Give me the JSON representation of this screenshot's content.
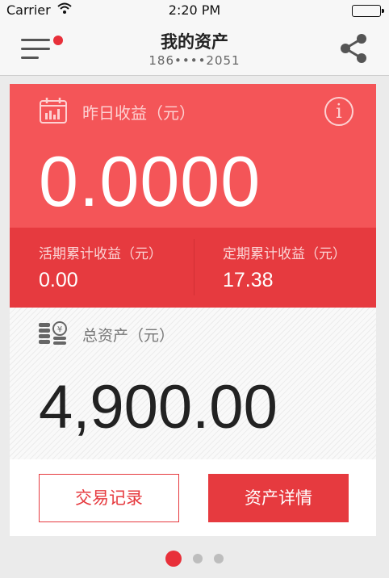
{
  "status_bar": {
    "carrier": "Carrier",
    "time": "2:20 PM"
  },
  "nav": {
    "title": "我的资产",
    "subtitle": "186••••2051"
  },
  "yesterday": {
    "label": "昨日收益（元）",
    "value": "0.0000"
  },
  "current": {
    "label": "活期累计收益（元）",
    "value": "0.00"
  },
  "fixed": {
    "label": "定期累计收益（元）",
    "value": "17.38"
  },
  "total": {
    "label": "总资产（元）",
    "value": "4,900.00"
  },
  "buttons": {
    "transactions": "交易记录",
    "details": "资产详情"
  },
  "pager": {
    "count": 3,
    "active": 1
  },
  "colors": {
    "accent": "#e63a3f",
    "accent_light": "#f45558"
  },
  "icons": [
    "wifi-icon",
    "battery-icon",
    "menu-icon",
    "share-icon",
    "calendar-chart-icon",
    "info-icon",
    "coins-icon"
  ]
}
